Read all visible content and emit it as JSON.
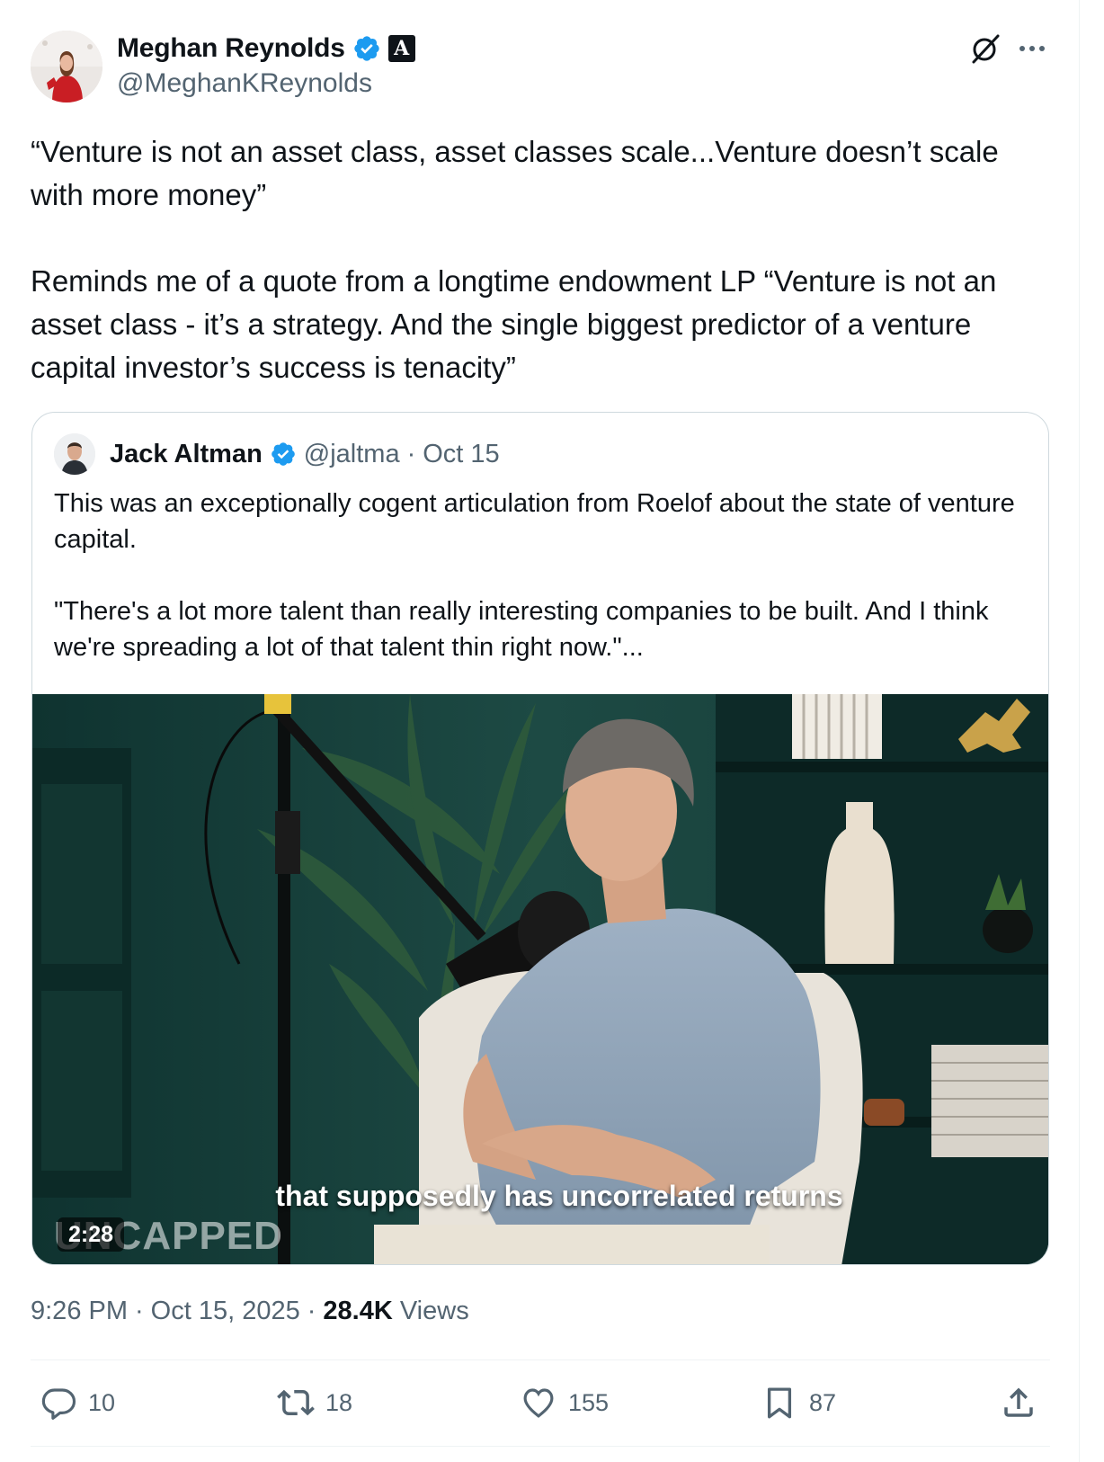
{
  "author": {
    "display_name": "Meghan Reynolds",
    "handle": "@MeghanKReynolds",
    "affiliate_badge": "A",
    "verified_icon": "verified-badge-icon"
  },
  "tweet": {
    "paragraph_1": "“Venture is not an asset class, asset classes scale...Venture doesn’t scale with more money”",
    "paragraph_2": "Reminds me of a quote from a longtime endowment LP “Venture is not an asset class - it’s a strategy. And the single biggest predictor of a venture capital investor’s success is tenacity”"
  },
  "quoted": {
    "display_name": "Jack Altman",
    "handle": "@jaltma",
    "separator": "·",
    "date": "Oct 15",
    "paragraph_1": "This was an exceptionally cogent articulation from Roelof about the state of venture capital.",
    "paragraph_2": "\"There's a lot more talent than really interesting companies to be built. And I think we're spreading a lot of that talent thin right now.\"...",
    "video": {
      "subtitle": "that supposedly has uncorrelated returns",
      "watermark": "UNCAPPED",
      "duration": "2:28"
    }
  },
  "meta": {
    "time": "9:26 PM",
    "sep1": "·",
    "date": "Oct 15, 2025",
    "sep2": "·",
    "views_count": "28.4K",
    "views_label": "Views"
  },
  "actions": {
    "replies": "10",
    "retweets": "18",
    "likes": "155",
    "bookmarks": "87"
  },
  "colors": {
    "text_primary": "#0f1419",
    "text_secondary": "#536471",
    "verified_blue": "#1d9bf0",
    "border": "#cfd9de"
  }
}
